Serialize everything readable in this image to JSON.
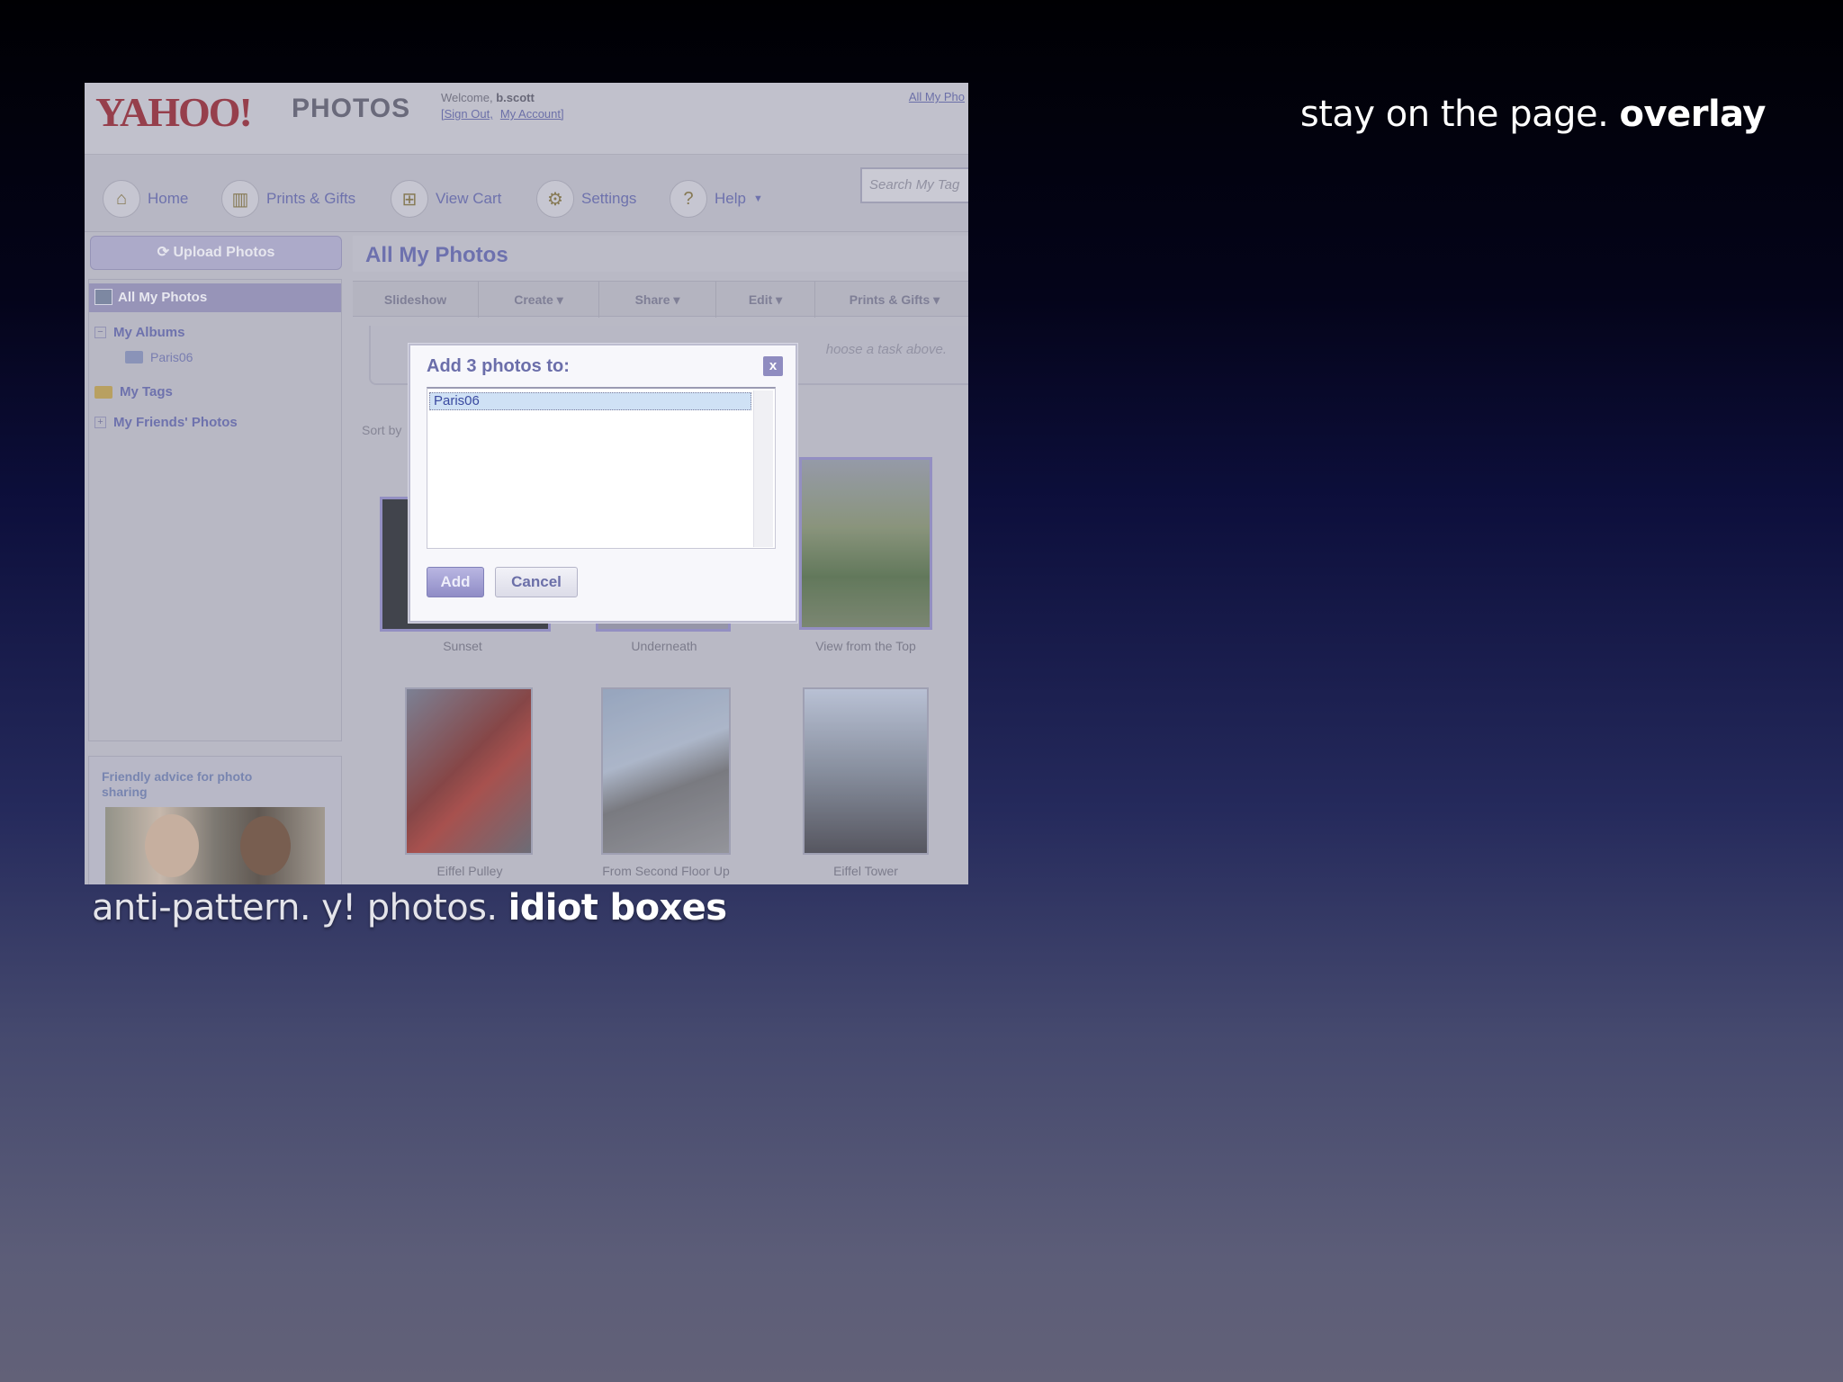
{
  "slide": {
    "title_regular": "stay on the page.",
    "title_bold": "overlay",
    "caption_regular": "anti-pattern. y! photos.",
    "caption_bold": "idiot boxes"
  },
  "app": {
    "logo": "YAHOO!",
    "product": "PHOTOS",
    "welcome_label": "Welcome,",
    "username": "b.scott",
    "sign_out": "[Sign Out,",
    "my_account": "My Account]",
    "all_my_photos_link": "All My Pho"
  },
  "nav": {
    "items": [
      {
        "label": "Home",
        "icon": "home-icon"
      },
      {
        "label": "Prints & Gifts",
        "icon": "gift-icon"
      },
      {
        "label": "View Cart",
        "icon": "cart-icon"
      },
      {
        "label": "Settings",
        "icon": "wrench-icon"
      },
      {
        "label": "Help",
        "icon": "help-icon"
      }
    ],
    "search_placeholder": "Search My Tag"
  },
  "sidebar": {
    "upload_label": "Upload Photos",
    "selected": "All My Photos",
    "albums": "My Albums",
    "album_child": "Paris06",
    "tags": "My Tags",
    "friends": "My Friends' Photos",
    "advice": "Friendly advice for photo sharing"
  },
  "main": {
    "title": "All My Photos",
    "tabs": [
      "Slideshow",
      "Create",
      "Share",
      "Edit",
      "Prints & Gifts"
    ],
    "hint": "hoose a task above.",
    "sort_label": "Sort by",
    "photos": [
      {
        "label": "Sunset"
      },
      {
        "label": "Underneath"
      },
      {
        "label": "View from the Top"
      },
      {
        "label": "Eiffel Pulley"
      },
      {
        "label": "From Second Floor Up"
      },
      {
        "label": "Eiffel Tower"
      }
    ]
  },
  "dialog": {
    "title": "Add 3 photos to:",
    "close": "x",
    "option": "Paris06",
    "add_label": "Add",
    "cancel_label": "Cancel"
  }
}
